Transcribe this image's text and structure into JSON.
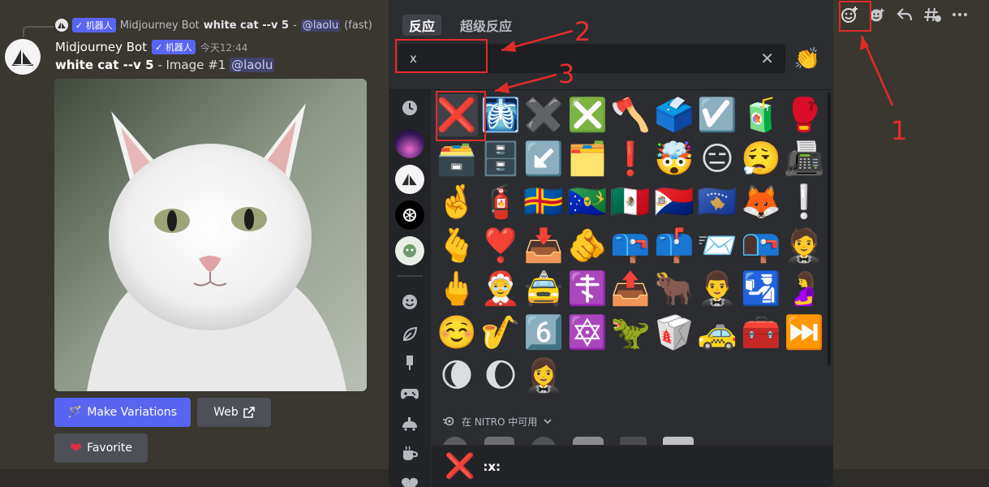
{
  "reply": {
    "badge": "✓ 机器人",
    "author": "Midjourney Bot",
    "prompt": "white cat --v 5",
    "separator": " - ",
    "mention": "@laolu",
    "mode": "(fast)"
  },
  "message": {
    "author": "Midjourney Bot",
    "badge": "✓ 机器人",
    "timestamp": "今天12:44",
    "prompt": "white cat --v 5",
    "image_label": " - Image #1 ",
    "mention": "@laolu"
  },
  "buttons": {
    "variations": "Make Variations",
    "web": "Web",
    "favorite": "Favorite"
  },
  "toolbar": {
    "icons": [
      "add-reaction-icon",
      "add-super-reaction-icon",
      "reply-icon",
      "create-thread-icon",
      "more-icon"
    ]
  },
  "picker": {
    "tabs": [
      "反应",
      "超级反应"
    ],
    "search_value": "x",
    "clear_glyph": "✕",
    "skin_tone_glyph": "👏",
    "nitro_label": "在 NITRO 中可用",
    "selected_glyph": "❌",
    "selected_name": ":x:",
    "rail_icons": [
      "clock-icon",
      "server-icon",
      "midjourney-icon",
      "openai-icon",
      "guild-icon",
      "smiley-icon",
      "leaf-icon",
      "food-icon",
      "game-controller-icon",
      "travel-icon",
      "object-icon",
      "heart-icon"
    ]
  },
  "emoji_grid": [
    [
      "❌",
      "🩻",
      "✖️",
      "❎",
      "🪓",
      "🗳️",
      "☑️",
      "🧃",
      "🥊"
    ],
    [
      "🗃️",
      "🗄️",
      "↙️",
      "🗂️",
      "❗",
      "🤯",
      "😑",
      "😮‍💨",
      "📠"
    ],
    [
      "🤞",
      "🧯",
      "🇦🇽",
      "🇨🇽",
      "🇲🇽",
      "🇸🇽",
      "🇽🇰",
      "🦊",
      "❕"
    ],
    [
      "🫰",
      "❣️",
      "📥",
      "🫵",
      "📪",
      "📫",
      "📨",
      "📭",
      "🤵"
    ],
    [
      "🖕",
      "🤶",
      "🚖",
      "☦️",
      "📤",
      "🐂",
      "🤵‍♂️",
      "🛂",
      "🤰"
    ],
    [
      "☺️",
      "🎷",
      "6️⃣",
      "🔯",
      "🦖",
      "🥡",
      "🚕",
      "🧰",
      "⏭️"
    ],
    [
      "🌘",
      "🌔",
      "🤵‍♀️"
    ]
  ],
  "annotations": [
    "1",
    "2",
    "3"
  ],
  "colors": {
    "accent": "#5865f2",
    "annotation": "#e02b2b"
  }
}
